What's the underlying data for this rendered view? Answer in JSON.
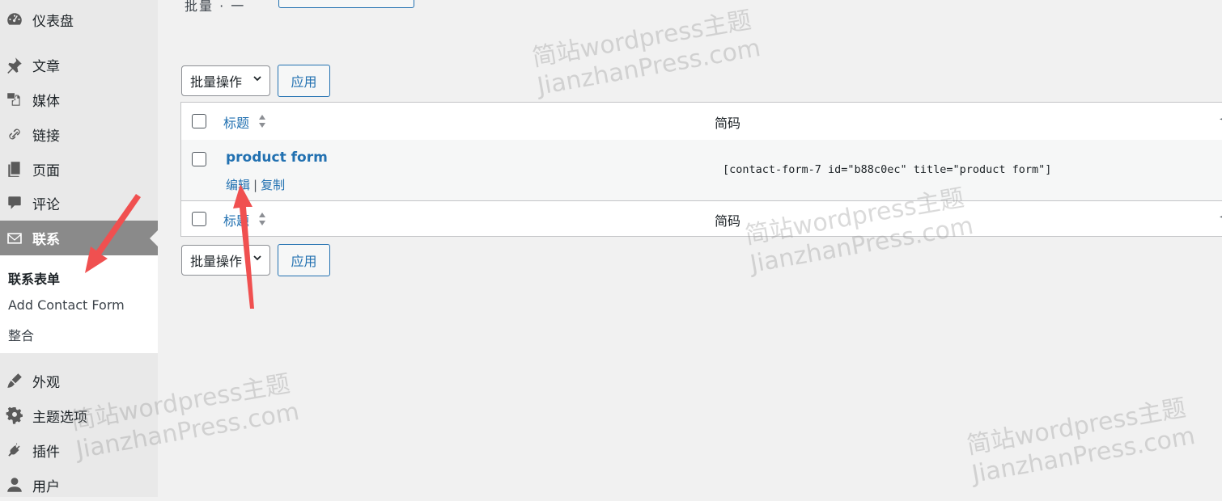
{
  "sidebar": {
    "items": [
      {
        "label": "仪表盘",
        "icon": "dashboard-icon"
      },
      {
        "label": "文章",
        "icon": "pin-icon"
      },
      {
        "label": "媒体",
        "icon": "media-icon"
      },
      {
        "label": "链接",
        "icon": "link-icon"
      },
      {
        "label": "页面",
        "icon": "page-icon"
      },
      {
        "label": "评论",
        "icon": "comment-icon"
      },
      {
        "label": "联系",
        "icon": "mail-icon"
      },
      {
        "label": "外观",
        "icon": "brush-icon"
      },
      {
        "label": "主题选项",
        "icon": "gear-icon"
      },
      {
        "label": "插件",
        "icon": "plug-icon"
      },
      {
        "label": "用户",
        "icon": "user-icon"
      }
    ],
    "submenu": [
      "联系表单",
      "Add Contact Form",
      "整合"
    ]
  },
  "top": {
    "fragment": "批量 · 一"
  },
  "bulk": {
    "select_label": "批量操作",
    "apply_label": "应用"
  },
  "table": {
    "columns": {
      "title": "标题",
      "shortcode": "简码"
    },
    "edge_mark": "◄",
    "rows": [
      {
        "title": "product form",
        "actions": [
          "编辑",
          "复制"
        ],
        "shortcode": "[contact-form-7 id=\"b88c0ec\" title=\"product form\"]"
      }
    ]
  },
  "watermark": {
    "line1": "简站wordpress主题",
    "line2": "JianzhanPress.com"
  },
  "colors": {
    "link": "#2271b1",
    "annotation_arrow": "#f05050",
    "active_menu": "#8a8a8a"
  }
}
